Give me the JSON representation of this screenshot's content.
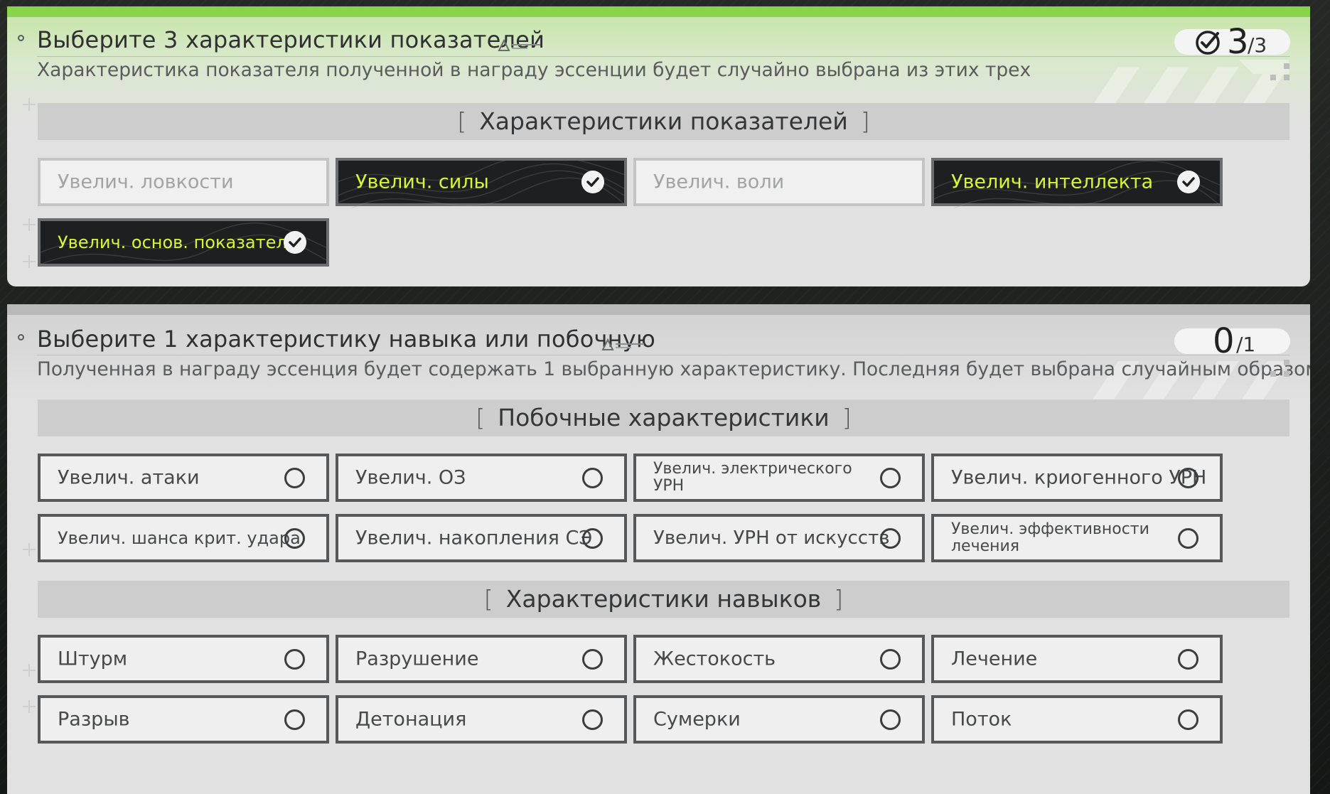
{
  "stat_section": {
    "title": "Выберите 3 характеристики показателей",
    "counter": {
      "current": "3",
      "total": "/3"
    },
    "description": "Характеристика показателя полученной в награду эссенции будет случайно выбрана из этих трех",
    "group_title": "Характеристики показателей",
    "options": [
      {
        "label": "Увелич. ловкости",
        "state": "disabled"
      },
      {
        "label": "Увелич. силы",
        "state": "selected"
      },
      {
        "label": "Увелич. воли",
        "state": "disabled"
      },
      {
        "label": "Увелич. интеллекта",
        "state": "selected"
      },
      {
        "label": "Увелич. основ. показателя",
        "state": "selected"
      }
    ]
  },
  "skill_section": {
    "title": "Выберите 1 характеристику навыка или побочную",
    "counter": {
      "current": "0",
      "total": "/1"
    },
    "description": "Полученная в награду эссенция будет содержать 1 выбранную характеристику. Последняя будет выбрана случайным образом.",
    "secondary_group_title": "Побочные характеристики",
    "secondary_options": [
      {
        "label": "Увелич. атаки"
      },
      {
        "label": "Увелич. ОЗ"
      },
      {
        "label": "Увелич. электрического УРН"
      },
      {
        "label": "Увелич. криогенного УРН"
      },
      {
        "label": "Увелич. шанса крит. удара"
      },
      {
        "label": "Увелич. накопления СЭ"
      },
      {
        "label": "Увелич. УРН от искусств"
      },
      {
        "label": "Увелич. эффективности лечения"
      }
    ],
    "skill_group_title": "Характеристики навыков",
    "skill_options": [
      {
        "label": "Штурм"
      },
      {
        "label": "Разрушение"
      },
      {
        "label": "Жестокость"
      },
      {
        "label": "Лечение"
      },
      {
        "label": "Разрыв"
      },
      {
        "label": "Детонация"
      },
      {
        "label": "Сумерки"
      },
      {
        "label": "Поток"
      }
    ]
  },
  "colors": {
    "accent_green": "#89d44a",
    "selected_text": "#d7f531",
    "selected_bg": "#1e1f20",
    "panel_bg": "#e1e1e1"
  }
}
